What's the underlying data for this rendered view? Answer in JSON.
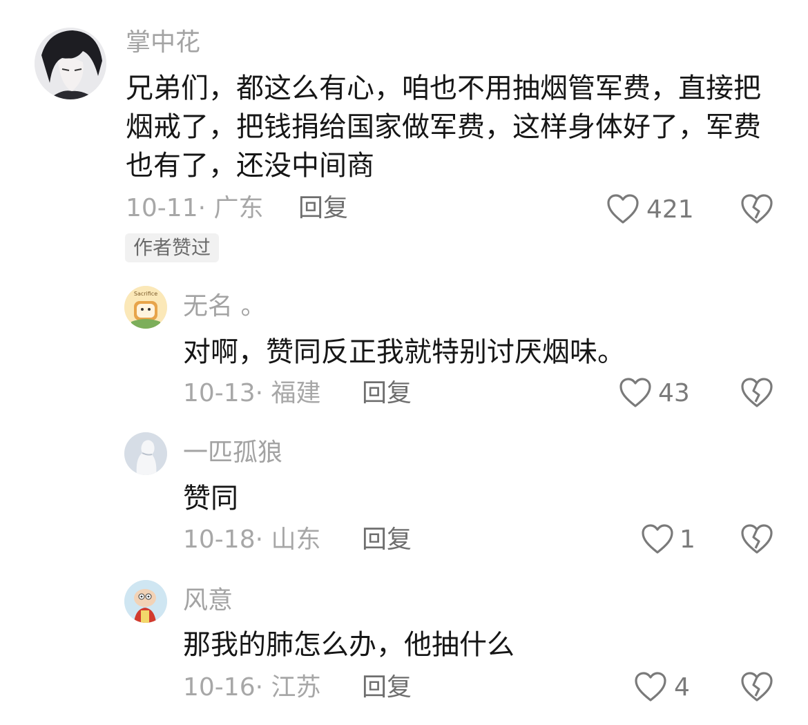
{
  "comments": [
    {
      "username": "掌中花",
      "text": "兄弟们，都这么有心，咱也不用抽烟管军费，直接把烟戒了，把钱捐给国家做军费，这样身体好了，军费也有了，还没中间商",
      "date_location": "10-11· 广东",
      "reply_label": "回复",
      "likes": "421",
      "badge": "作者赞过",
      "avatar": "dark-hair-anime-avatar"
    },
    {
      "username": "无名 。",
      "text": "对啊，赞同反正我就特别讨厌烟味。",
      "date_location": "10-13· 福建",
      "reply_label": "回复",
      "likes": "43",
      "avatar": "cartoon-toast-avatar",
      "avatar_caption": "Sacrifice"
    },
    {
      "username": "一匹孤狼",
      "text": "赞同",
      "date_location": "10-18· 山东",
      "reply_label": "回复",
      "likes": "1",
      "avatar": "white-figure-avatar"
    },
    {
      "username": "风意",
      "text": "那我的肺怎么办，他抽什么",
      "date_location": "10-16· 江苏",
      "reply_label": "回复",
      "likes": "4",
      "avatar": "cartoon-baby-avatar"
    }
  ],
  "icons": {
    "like": "heart-outline-icon",
    "dislike": "broken-heart-icon"
  },
  "colors": {
    "text": "#161616",
    "username": "#a3a3a3",
    "meta": "#a7a7a7",
    "icon": "#7a7a7a"
  }
}
